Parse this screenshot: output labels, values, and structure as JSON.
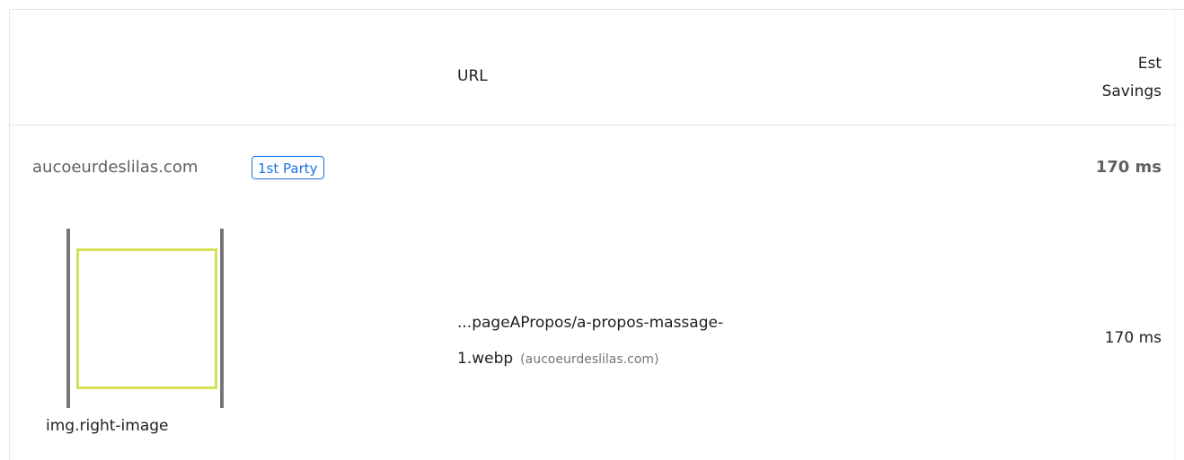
{
  "table": {
    "headers": {
      "url": "URL",
      "savings_line1": "Est",
      "savings_line2": "Savings"
    },
    "group": {
      "entity": "aucoeurdeslilas.com",
      "badge": "1st Party",
      "savings": "170 ms"
    },
    "items": [
      {
        "node_label": "img.right-image",
        "url_line1": "...pageAPropos/a-propos-massage-",
        "url_line2": "1.webp",
        "origin": "(aucoeurdeslilas.com)",
        "savings": "170 ms"
      }
    ]
  },
  "colors": {
    "badge": "#1a73e8",
    "highlight": "#d4e157",
    "muted_text": "#616161",
    "border": "#e6e6e6"
  }
}
